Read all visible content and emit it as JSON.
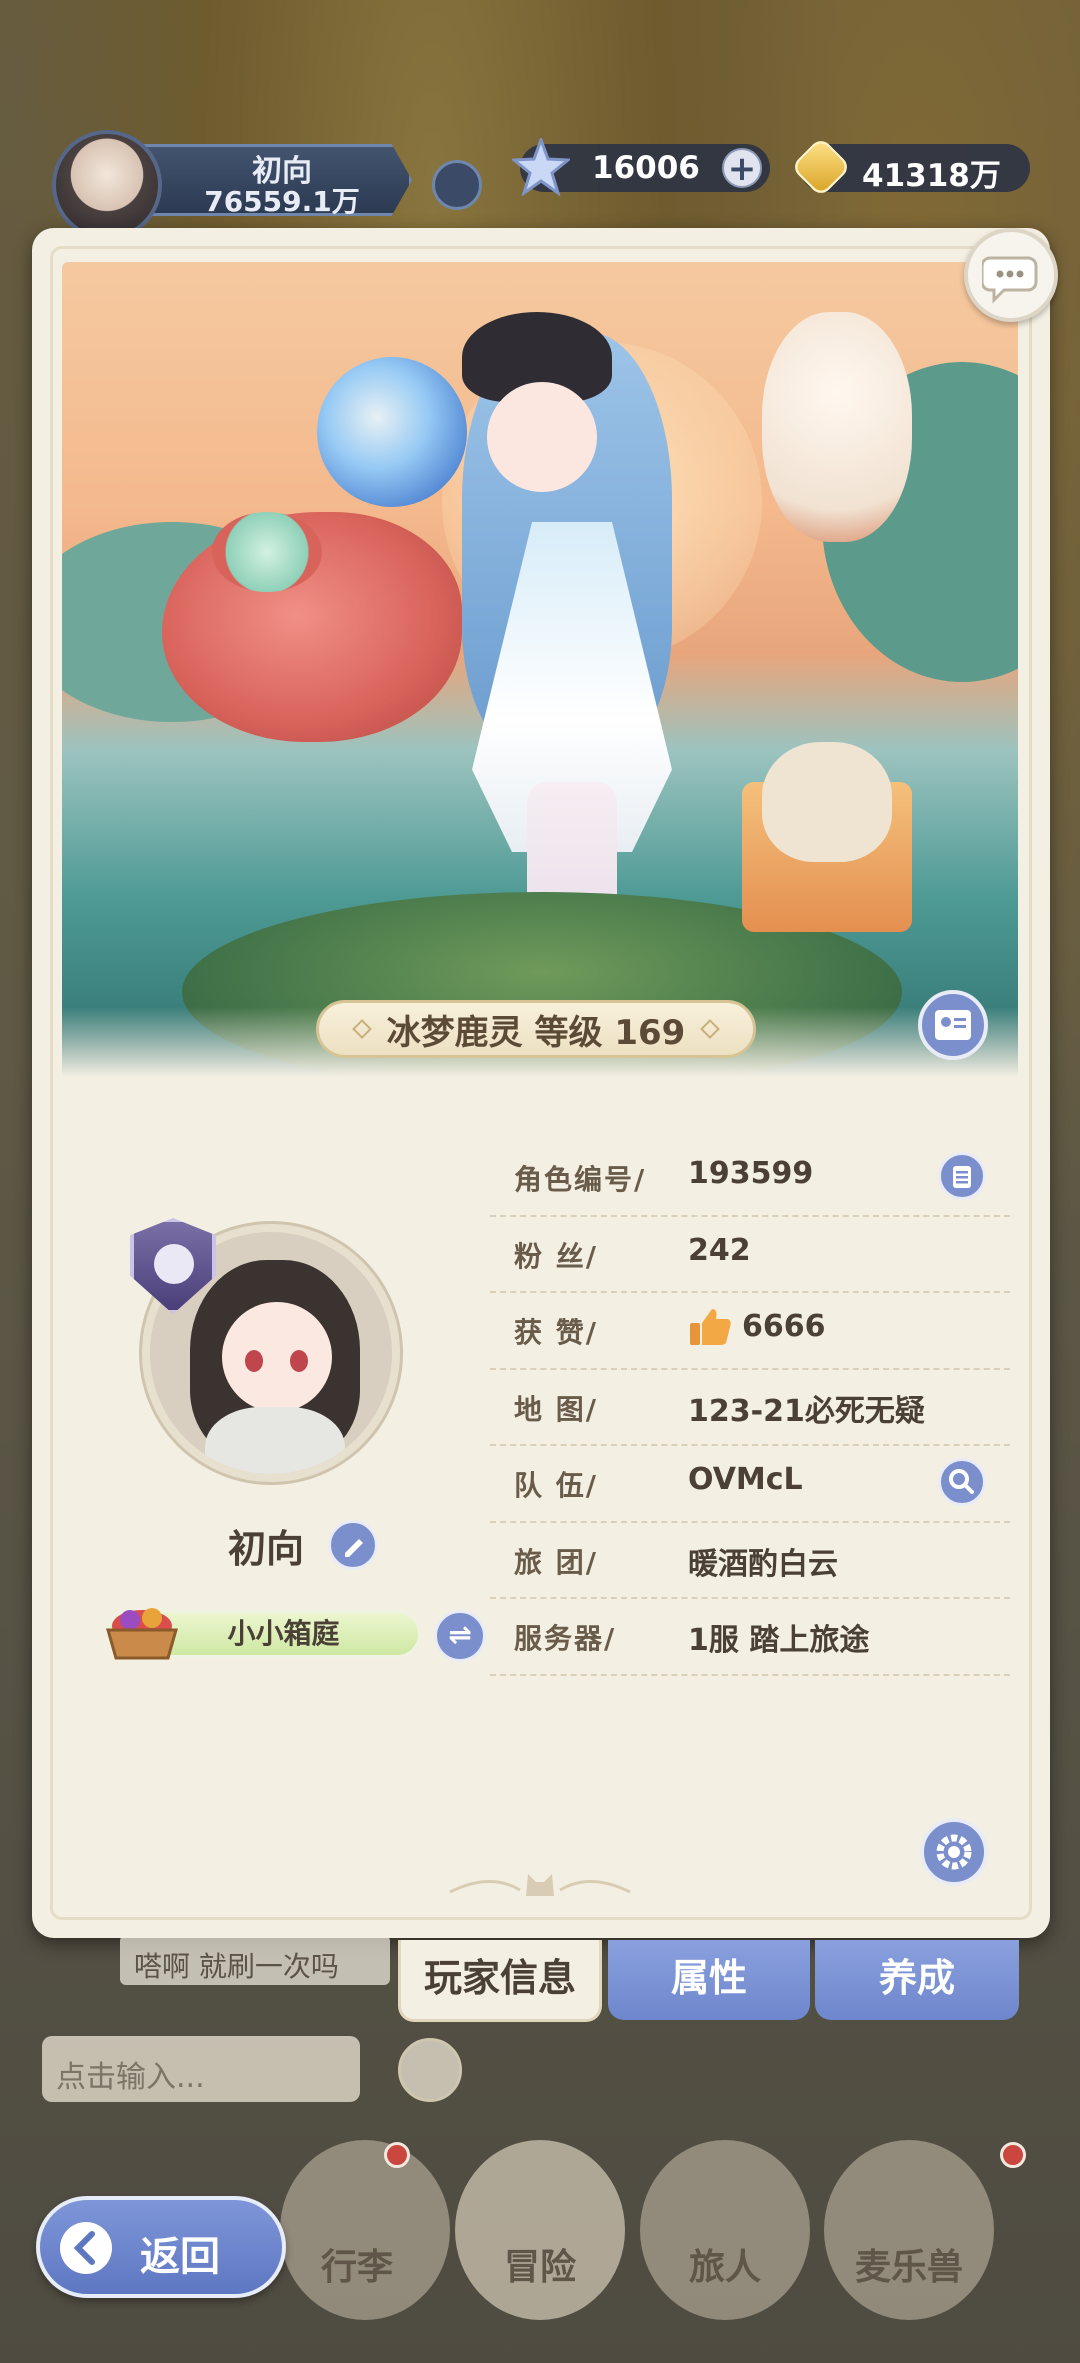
{
  "top_bar": {
    "player_name": "初向",
    "power": "76559.1万",
    "gems": "16006",
    "gold": "41318万"
  },
  "character": {
    "title": "冰梦鹿灵 等级 169"
  },
  "profile": {
    "name": "初向",
    "home": "小小箱庭"
  },
  "info_rows": [
    {
      "label": "角色编号/",
      "value": "193599"
    },
    {
      "label": "粉    丝/",
      "value": "242"
    },
    {
      "label": "获    赞/",
      "value": "6666"
    },
    {
      "label": "地    图/",
      "value": "123-21必死无疑"
    },
    {
      "label": "队    伍/",
      "value": "OVMcL"
    },
    {
      "label": "旅    团/",
      "value": "暖酒酌白云"
    },
    {
      "label": "服务器/",
      "value": "1服  踏上旅途"
    }
  ],
  "tabs": {
    "info": "玩家信息",
    "attributes": "属性",
    "growth": "养成"
  },
  "bottom": {
    "chat_preview": "嗒啊  就刷一次吗",
    "chat_placeholder": "点击输入...",
    "nav": [
      {
        "label": "行李"
      },
      {
        "label": "冒险"
      },
      {
        "label": "旅人"
      },
      {
        "label": "麦乐兽"
      }
    ],
    "back_label": "返回"
  },
  "colors": {
    "panel": "#f4efe3",
    "accent_blue": "#7a8fcb",
    "text_brown": "#4a4036"
  }
}
